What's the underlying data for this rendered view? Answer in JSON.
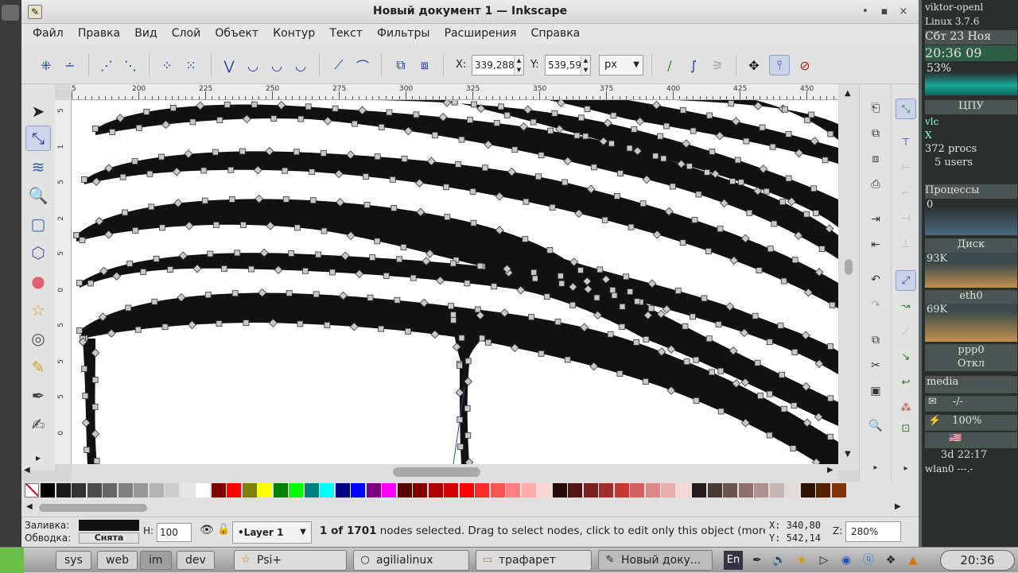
{
  "window": {
    "title": "Новый документ 1 — Inkscape",
    "controls": [
      "•",
      "▪",
      "×"
    ]
  },
  "menu": [
    "Файл",
    "Правка",
    "Вид",
    "Слой",
    "Объект",
    "Контур",
    "Текст",
    "Фильтры",
    "Расширения",
    "Справка"
  ],
  "nodebar": {
    "x_label": "X:",
    "x_value": "339,288",
    "y_label": "Y:",
    "y_value": "539,594",
    "unit": "px"
  },
  "ruler": {
    "labels": [
      "5",
      "200",
      "225",
      "250",
      "275",
      "300",
      "325",
      "350",
      "375",
      "400",
      "425",
      "450"
    ],
    "vlabels": [
      "5",
      "1",
      "5",
      "2",
      "5",
      "0",
      "5",
      "5",
      "5",
      "0"
    ]
  },
  "status": {
    "fill_label": "Заливка:",
    "stroke_label": "Обводка:",
    "stroke_value": "Снята",
    "h_label": "H:",
    "h_value": "100",
    "layer": "•Layer 1",
    "message_bold": "1 of 1701",
    "message": " nodes selected. Drag to select nodes, click to edit only this object (more",
    "x_coord": "X:  340,80",
    "y_coord": "Y:  542,14",
    "zoom_label": "Z:",
    "zoom": "280%"
  },
  "palette": {
    "colors": [
      "#000000",
      "#1a1a1a",
      "#333333",
      "#4d4d4d",
      "#666666",
      "#808080",
      "#999999",
      "#b3b3b3",
      "#cccccc",
      "#e6e6e6",
      "#ffffff",
      "#800000",
      "#ff0000",
      "#808000",
      "#ffff00",
      "#008000",
      "#00ff00",
      "#008080",
      "#00ffff",
      "#000080",
      "#0000ff",
      "#800080",
      "#ff00ff",
      "#550000",
      "#800000",
      "#aa0000",
      "#d40000",
      "#ff0000",
      "#ff2a2a",
      "#ff5555",
      "#ff8080",
      "#ffaaaa",
      "#ffd5d5",
      "#280b0b",
      "#501616",
      "#782121",
      "#a02c2c",
      "#c83737",
      "#d35f5f",
      "#de8787",
      "#e9afaf",
      "#f4d7d7",
      "#241c1c",
      "#483737",
      "#6c5353",
      "#916f6f",
      "#ac9393",
      "#c8b7b7",
      "#e3dbdb",
      "#2b1100",
      "#552200",
      "#803300"
    ]
  },
  "conky": {
    "host": "viktor-openl",
    "kernel": "Linux 3.7.6",
    "date": "Сбт 23 Ноя",
    "time": "20:36 09",
    "cpu_pct": "53%",
    "cpu_label": "ЦПУ",
    "vlc": "vlc",
    "x": "X",
    "procs": "372 procs",
    "users": "5 users",
    "procs_label": "Процессы",
    "procs_zero": "0",
    "disk_label": "Диск",
    "disk_val": "93K",
    "eth_label": "eth0",
    "eth_val": "69K",
    "ppp_label": "ppp0",
    "off_label": "Откл",
    "media": "media",
    "mail": "-/-",
    "battery": "100%",
    "uptime": "3d 22:17",
    "wlan": "wlan0 ---.-"
  },
  "taskbar": {
    "workspaces": [
      "sys",
      "web",
      "im",
      "dev"
    ],
    "tasks": [
      {
        "label": "Psi+",
        "icon": "☆"
      },
      {
        "label": "agilialinux",
        "icon": "○"
      },
      {
        "label": "трафарет",
        "icon": "▭"
      },
      {
        "label": "Новый доку...",
        "icon": "✎"
      }
    ],
    "lang": "En",
    "clock": "20:36"
  }
}
